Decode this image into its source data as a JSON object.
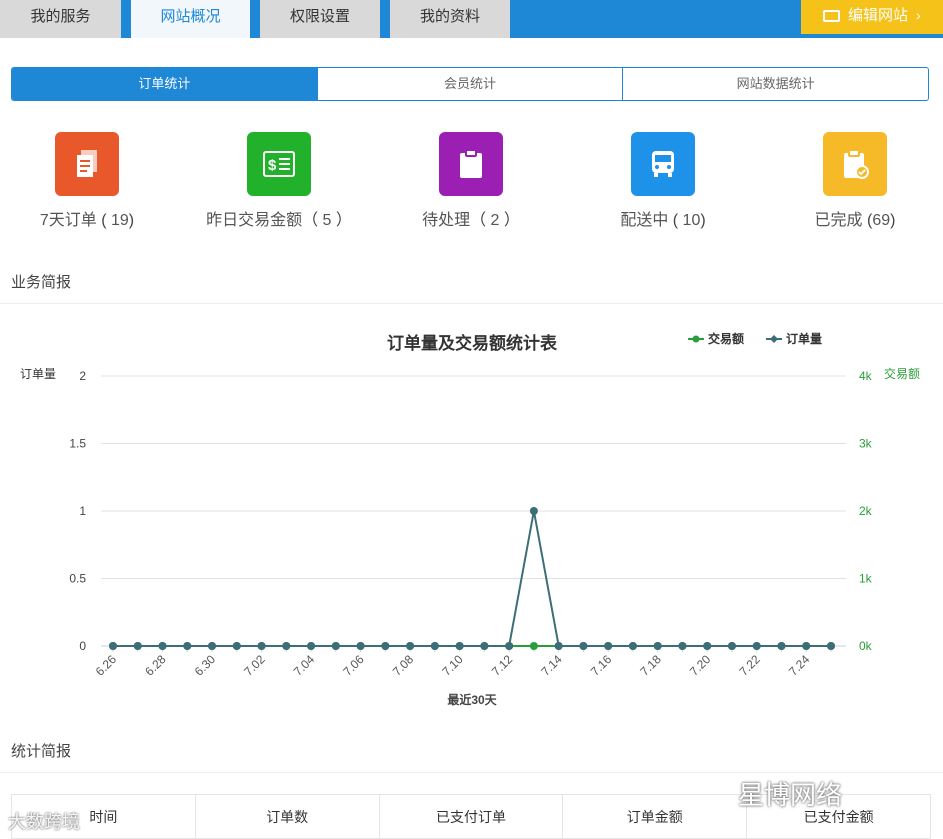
{
  "tabs": [
    "我的服务",
    "网站概况",
    "权限设置",
    "我的资料"
  ],
  "edit_button": "编辑网站",
  "segments": [
    "订单统计",
    "会员统计",
    "网站数据统计"
  ],
  "stats": [
    {
      "label": "7天订单",
      "count": "19",
      "color": "#e8582a",
      "icon": "document-icon"
    },
    {
      "label": "昨日交易金额",
      "count": "5",
      "color": "#22b12b",
      "icon": "receipt-icon"
    },
    {
      "label": "待处理",
      "count": "2",
      "color": "#9b1fb3",
      "icon": "clipboard-icon"
    },
    {
      "label": "配送中",
      "count": "10",
      "color": "#1e92e8",
      "icon": "bus-icon"
    },
    {
      "label": "已完成",
      "count": "69",
      "color": "#f6b928",
      "icon": "clipboard-check-icon"
    }
  ],
  "section_business": "业务简报",
  "section_stats": "统计简报",
  "table_headers": [
    "时间",
    "订单数",
    "已支付订单",
    "订单金额",
    "已支付金额"
  ],
  "watermarks": {
    "left": "大数跨境",
    "right": "星博网络"
  },
  "chart_data": {
    "type": "line",
    "title": "订单量及交易额统计表",
    "xlabel": "最近30天",
    "ylabel_left": "订单量",
    "ylabel_right": "交易额",
    "x": [
      "6.26",
      "6.27",
      "6.28",
      "6.29",
      "6.30",
      "7.01",
      "7.02",
      "7.03",
      "7.04",
      "7.05",
      "7.06",
      "7.07",
      "7.08",
      "7.09",
      "7.10",
      "7.11",
      "7.12",
      "7.13",
      "7.14",
      "7.15",
      "7.16",
      "7.17",
      "7.18",
      "7.19",
      "7.20",
      "7.21",
      "7.22",
      "7.23",
      "7.24",
      "7.25"
    ],
    "x_tick_labels": [
      "6.26",
      "6.28",
      "6.30",
      "7.02",
      "7.04",
      "7.06",
      "7.08",
      "7.10",
      "7.12",
      "7.14",
      "7.16",
      "7.18",
      "7.20",
      "7.22",
      "7.24"
    ],
    "ylim_left": [
      0,
      2
    ],
    "yticks_left": [
      "0",
      "0.5",
      "1",
      "1.5",
      "2"
    ],
    "ylim_right": [
      0,
      4
    ],
    "yticks_right": [
      "0k",
      "1k",
      "2k",
      "3k",
      "4k"
    ],
    "legend_position": "top-right",
    "series": [
      {
        "name": "交易额",
        "axis": "right",
        "color": "#2a9d3a",
        "values": [
          0,
          0,
          0,
          0,
          0,
          0,
          0,
          0,
          0,
          0,
          0,
          0,
          0,
          0,
          0,
          0,
          0,
          0,
          0,
          0,
          0,
          0,
          0,
          0,
          0,
          0,
          0,
          0,
          0,
          0
        ]
      },
      {
        "name": "订单量",
        "axis": "left",
        "color": "#3d6e78",
        "values": [
          0,
          0,
          0,
          0,
          0,
          0,
          0,
          0,
          0,
          0,
          0,
          0,
          0,
          0,
          0,
          0,
          0,
          1,
          0,
          0,
          0,
          0,
          0,
          0,
          0,
          0,
          0,
          0,
          0,
          0
        ]
      }
    ]
  }
}
